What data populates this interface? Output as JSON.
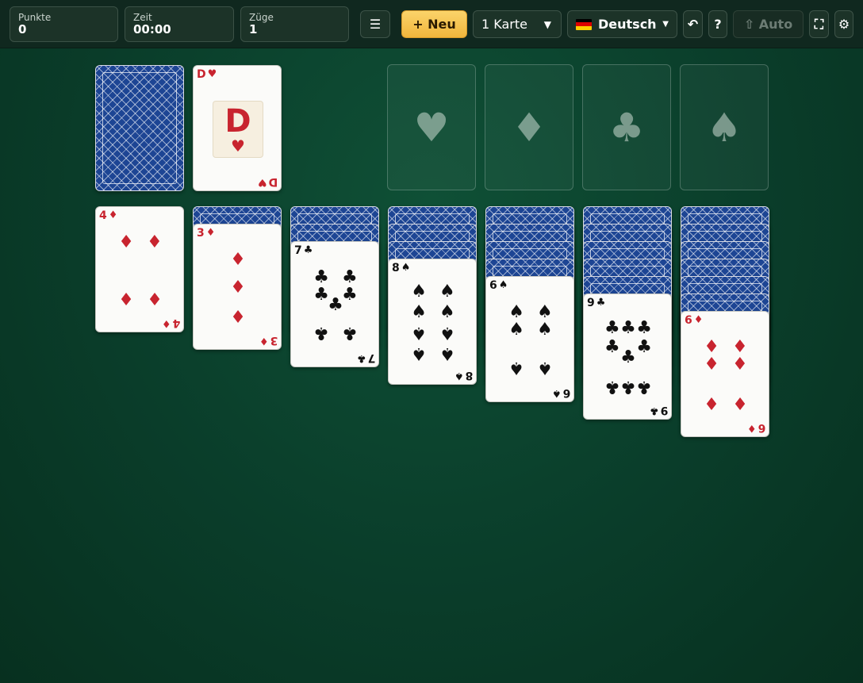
{
  "stats": {
    "points": {
      "label": "Punkte",
      "value": "0"
    },
    "time": {
      "label": "Zeit",
      "value": "00:00"
    },
    "moves": {
      "label": "Züge",
      "value": "1"
    }
  },
  "toolbar": {
    "menu_icon": "☰",
    "new_label": "+ Neu",
    "draw_mode": "1 Karte",
    "language": "Deutsch",
    "undo_icon": "↶",
    "help_label": "?",
    "auto_label": "⇧ Auto",
    "fullscreen_icon": "⛶",
    "settings_icon": "⚙"
  },
  "colors": {
    "red_suit": "#c8242f",
    "card_back": "#1d4594",
    "table": "#0a3d2a"
  },
  "waste": {
    "rank": "D",
    "suit": "♥",
    "color": "red"
  },
  "foundations": [
    {
      "suit": "♥",
      "name": "hearts"
    },
    {
      "suit": "♦",
      "name": "diamonds"
    },
    {
      "suit": "♣",
      "name": "clubs"
    },
    {
      "suit": "♠",
      "name": "spades"
    }
  ],
  "tableau": [
    {
      "hidden": 0,
      "rank": "4",
      "suit": "♦",
      "color": "red"
    },
    {
      "hidden": 1,
      "rank": "3",
      "suit": "♦",
      "color": "red"
    },
    {
      "hidden": 2,
      "rank": "7",
      "suit": "♣",
      "color": "black"
    },
    {
      "hidden": 3,
      "rank": "8",
      "suit": "♠",
      "color": "black"
    },
    {
      "hidden": 4,
      "rank": "6",
      "suit": "♠",
      "color": "black"
    },
    {
      "hidden": 5,
      "rank": "9",
      "suit": "♣",
      "color": "black"
    },
    {
      "hidden": 6,
      "rank": "6",
      "suit": "♦",
      "color": "red"
    }
  ]
}
